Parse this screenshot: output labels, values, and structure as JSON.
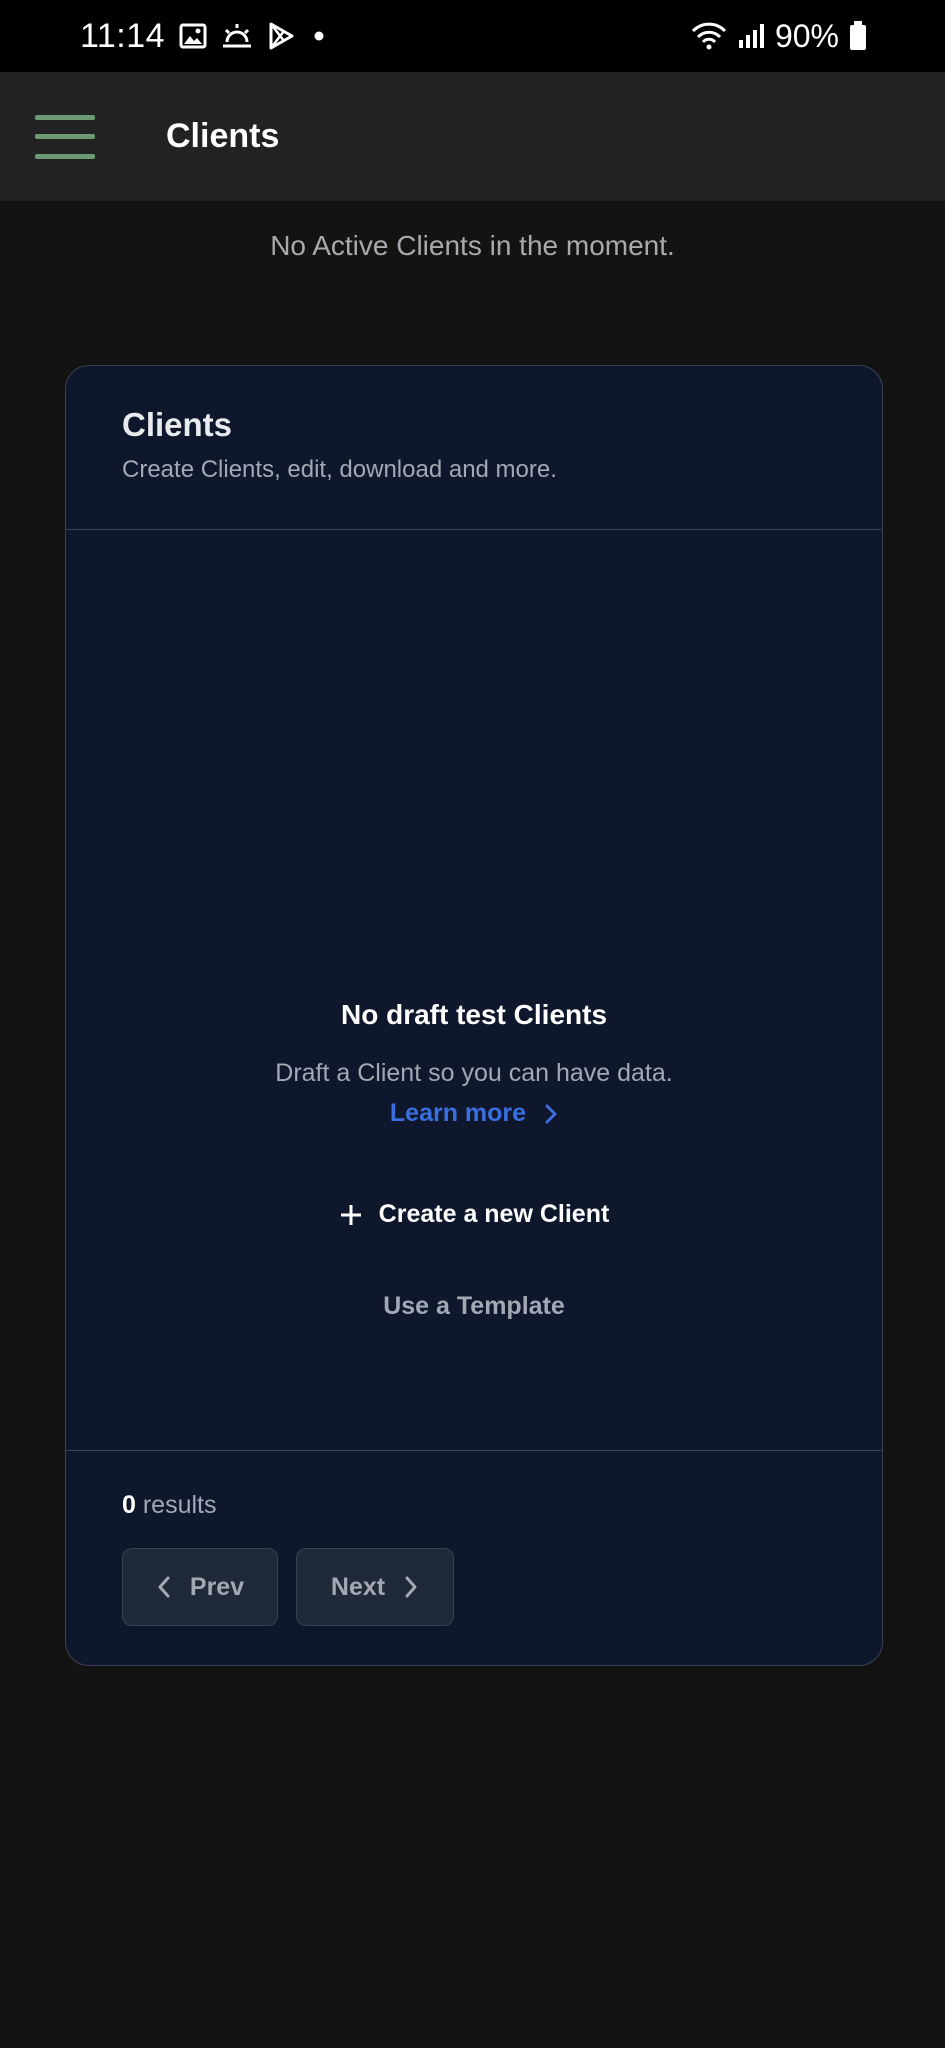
{
  "status_bar": {
    "time": "11:14",
    "battery": "90%",
    "icons": [
      "gallery-icon",
      "weather-icon",
      "play-store-icon",
      "dot-icon",
      "wifi-icon",
      "signal-icon",
      "battery-icon"
    ]
  },
  "app_bar": {
    "title": "Clients",
    "menu_icon": "hamburger-menu-icon"
  },
  "notice": "No Active Clients in the moment.",
  "card": {
    "title": "Clients",
    "subtitle": "Create Clients, edit, download and more.",
    "empty": {
      "heading": "No draft test Clients",
      "description": "Draft a Client so you can have data.",
      "learn_more": "Learn more",
      "create_label": "Create a new Client",
      "template_label": "Use a Template"
    },
    "footer": {
      "results_count": "0",
      "results_label": "results",
      "prev_label": "Prev",
      "next_label": "Next"
    }
  },
  "colors": {
    "menu_accent": "#6b9a75",
    "link": "#3b6fe0",
    "card_bg": "#0e172b",
    "page_bg": "#131313"
  }
}
